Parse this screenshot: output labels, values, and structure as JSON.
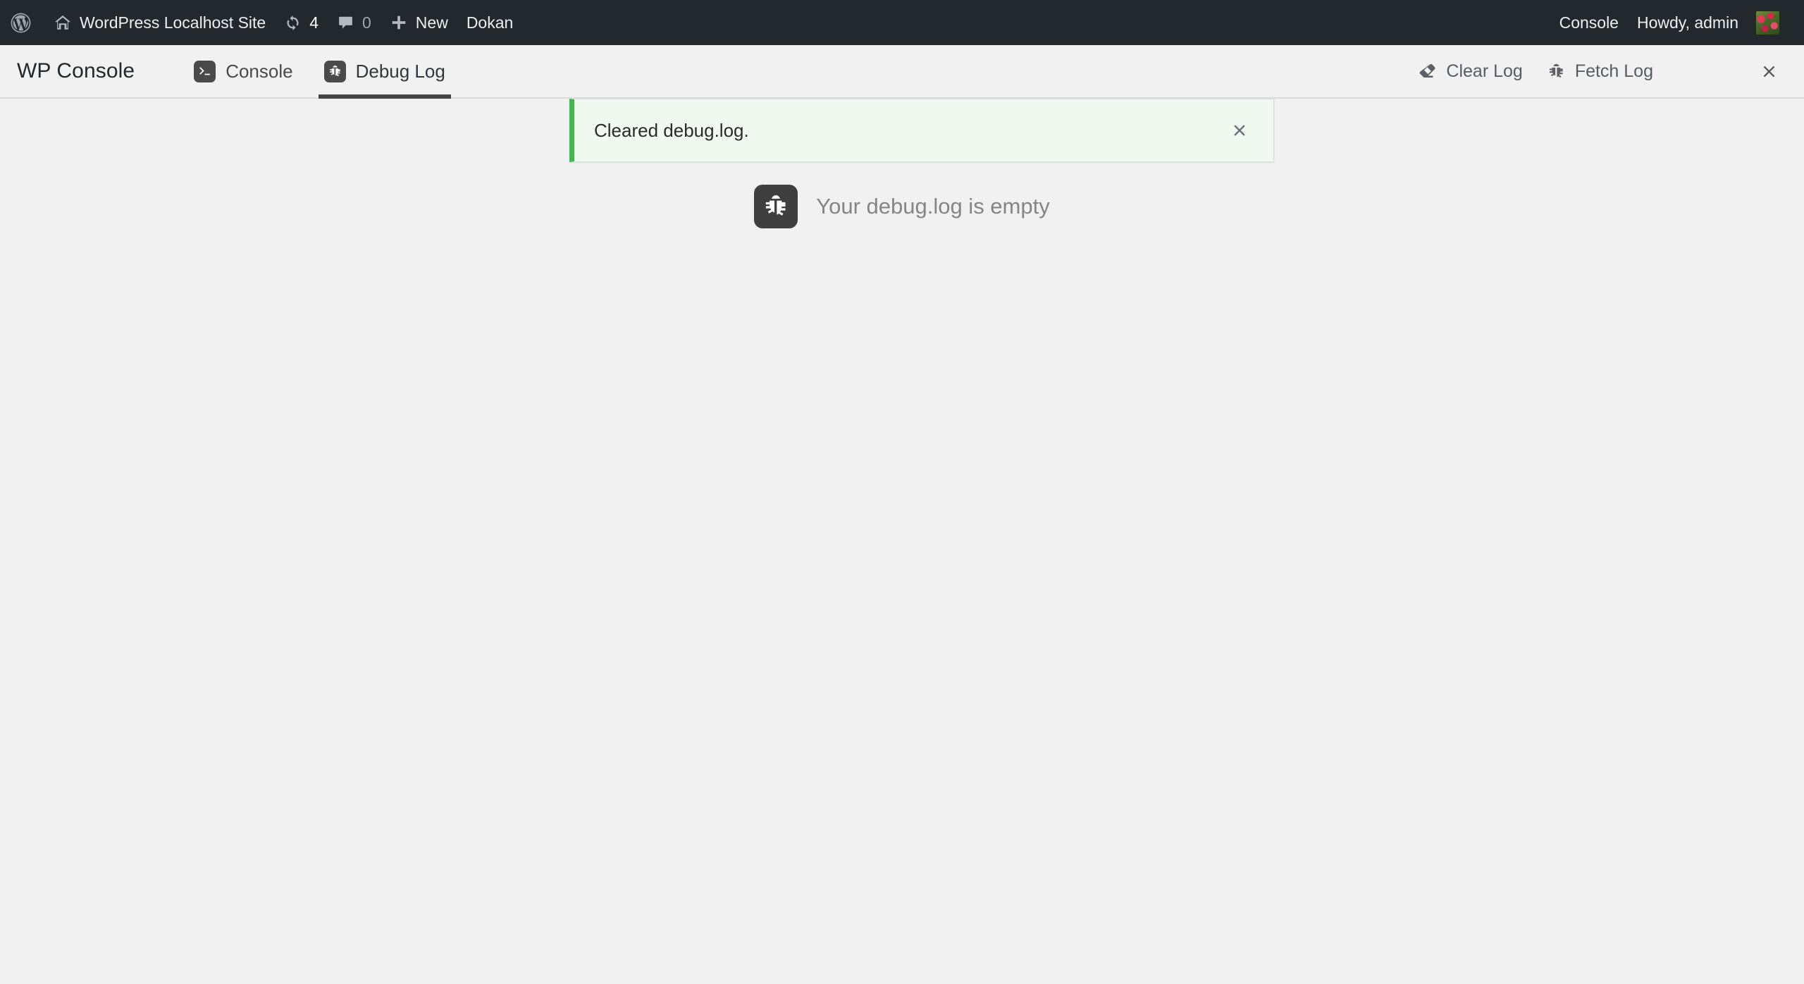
{
  "admin_bar": {
    "site_logo_icon": "wordpress-logo-icon",
    "home_icon": "home-icon",
    "site_title": "WordPress Localhost Site",
    "updates": {
      "icon": "updates-sync-icon",
      "count": "4"
    },
    "comments": {
      "icon": "comment-bubble-icon",
      "count": "0"
    },
    "new": {
      "icon": "plus-icon",
      "label": "New"
    },
    "dokan": {
      "label": "Dokan"
    },
    "right": {
      "console_label": "Console",
      "howdy_label": "Howdy, admin",
      "avatar_icon": "user-avatar"
    }
  },
  "console_header": {
    "brand": "WP Console",
    "tabs": [
      {
        "label": "Console",
        "icon": "terminal-prompt-icon",
        "active": false
      },
      {
        "label": "Debug Log",
        "icon": "bug-icon",
        "active": true
      }
    ],
    "actions": [
      {
        "label": "Clear Log",
        "icon": "eraser-icon"
      },
      {
        "label": "Fetch Log",
        "icon": "bug-icon"
      }
    ],
    "close_icon": "close-icon"
  },
  "notice": {
    "message": "Cleared debug.log.",
    "dismiss_icon": "close-icon",
    "accent_color": "#46b450",
    "background_color": "#f0f9f0"
  },
  "content": {
    "empty_state": {
      "icon": "bug-icon",
      "message": "Your debug.log is empty"
    }
  },
  "colors": {
    "admin_bar_bg": "#23282d",
    "page_bg": "#f1f1f1",
    "icon_tile": "#4a4a4a",
    "active_tab_underline": "#444444"
  }
}
